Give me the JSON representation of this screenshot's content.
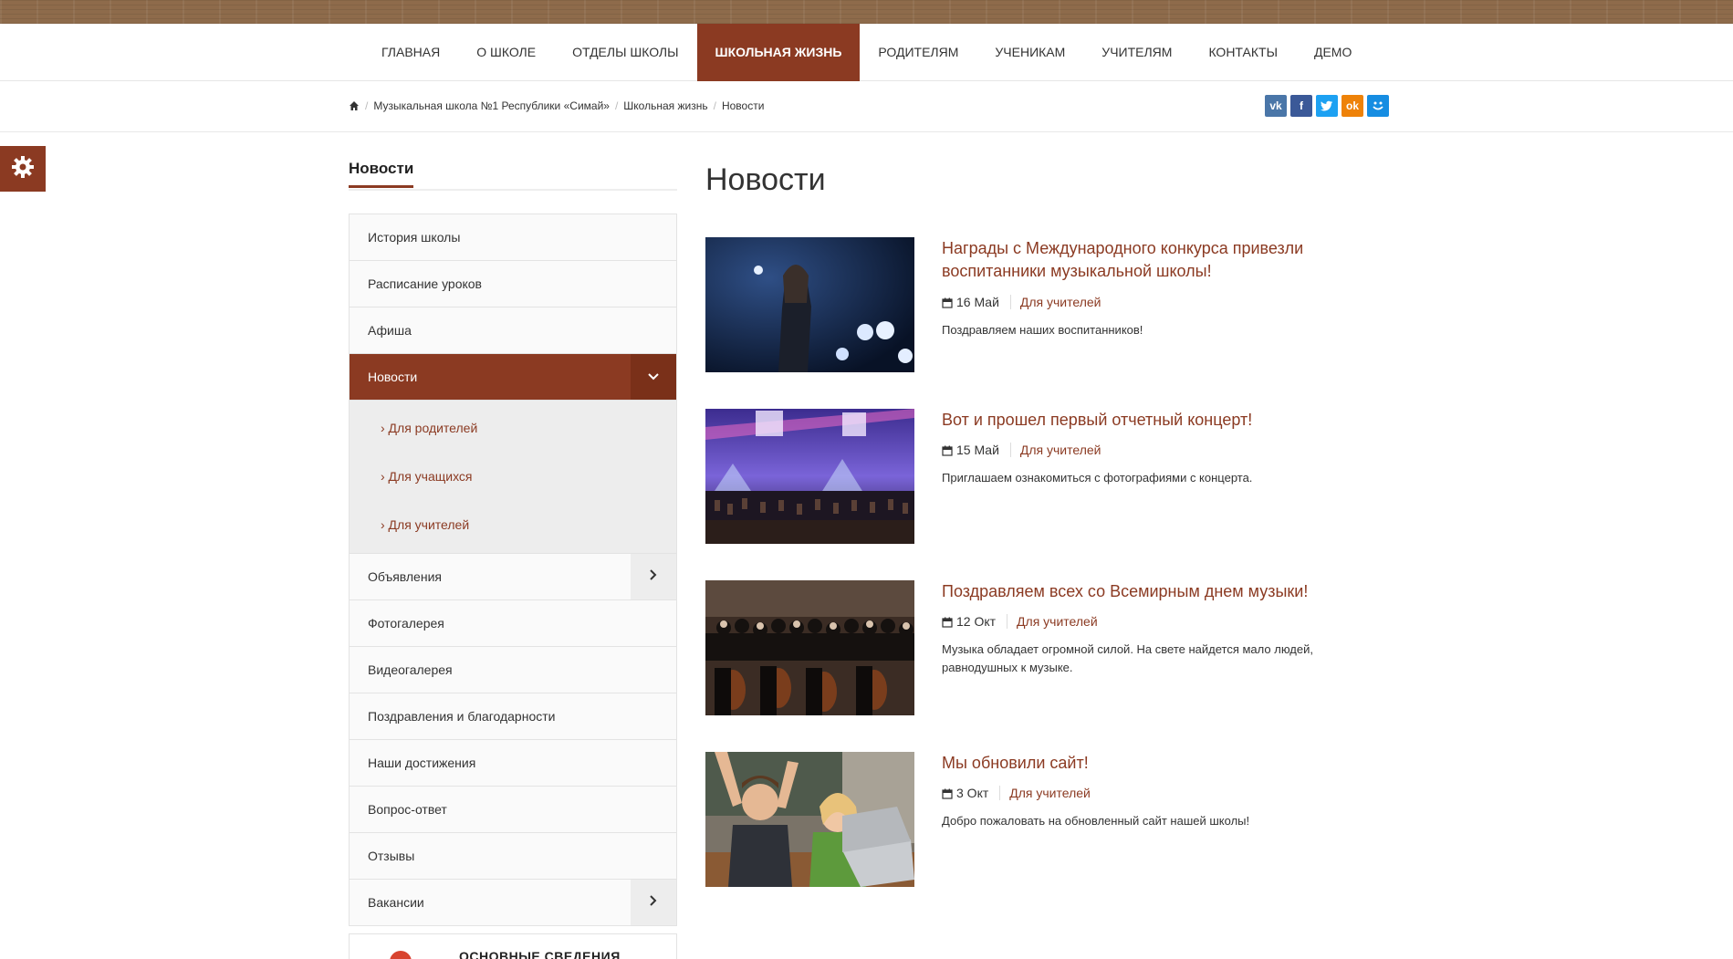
{
  "nav": {
    "items": [
      "ГЛАВНАЯ",
      "О ШКОЛЕ",
      "ОТДЕЛЫ ШКОЛЫ",
      "ШКОЛЬНАЯ ЖИЗНЬ",
      "РОДИТЕЛЯМ",
      "УЧЕНИКАМ",
      "УЧИТЕЛЯМ",
      "КОНТАКТЫ",
      "ДЕМО"
    ],
    "active": "ШКОЛЬНАЯ ЖИЗНЬ"
  },
  "breadcrumb": {
    "home_icon": "home-icon",
    "items": [
      "Музыкальная школа №1 Республики «Симай»",
      "Школьная жизнь",
      "Новости"
    ]
  },
  "social": {
    "icons": [
      "vk-icon",
      "facebook-icon",
      "twitter-icon",
      "odnoklassniki-icon",
      "moimir-icon"
    ],
    "colors": [
      "#4a76a8",
      "#3b5998",
      "#1da1f2",
      "#ee8208",
      "#168de2"
    ]
  },
  "settings": {
    "icon": "gear-icon"
  },
  "sidebar": {
    "title": "Новости",
    "items": [
      {
        "label": "История школы"
      },
      {
        "label": "Расписание уроков"
      },
      {
        "label": "Афиша"
      },
      {
        "label": "Новости",
        "active": true,
        "expanded": true,
        "sub": [
          "› Для родителей",
          "› Для учащихся",
          "› Для учителей"
        ]
      },
      {
        "label": "Объявления",
        "has_toggle": true
      },
      {
        "label": "Фотогалерея"
      },
      {
        "label": "Видеогалерея"
      },
      {
        "label": "Поздравления и благодарности"
      },
      {
        "label": "Наши достижения"
      },
      {
        "label": "Вопрос-ответ"
      },
      {
        "label": "Отзывы"
      },
      {
        "label": "Вакансии",
        "has_toggle": true
      }
    ],
    "info_box_label": "ОСНОВНЫЕ СВЕДЕНИЯ"
  },
  "main": {
    "title": "Новости",
    "news": [
      {
        "title": "Награды с Международного конкурса привезли воспитанники музыкальной школы!",
        "date": "16 Май",
        "category": "Для учителей",
        "text": "Поздравляем наших воспитанников!"
      },
      {
        "title": "Вот и прошел первый отчетный концерт!",
        "date": "15 Май",
        "category": "Для учителей",
        "text": "Приглашаем ознакомиться с фотографиями с концерта."
      },
      {
        "title": "Поздравляем всех со Всемирным днем музыки!",
        "date": "12 Окт",
        "category": "Для учителей",
        "text": "Музыка обладает огромной силой. На свете найдется мало людей, равнодушных к музыке."
      },
      {
        "title": "Мы обновили сайт!",
        "date": "3 Окт",
        "category": "Для учителей",
        "text": "Добро пожаловать на обновленный сайт нашей школы!"
      }
    ]
  },
  "colors": {
    "accent": "#8b3a22",
    "top_strip": "#8e6b4b"
  }
}
